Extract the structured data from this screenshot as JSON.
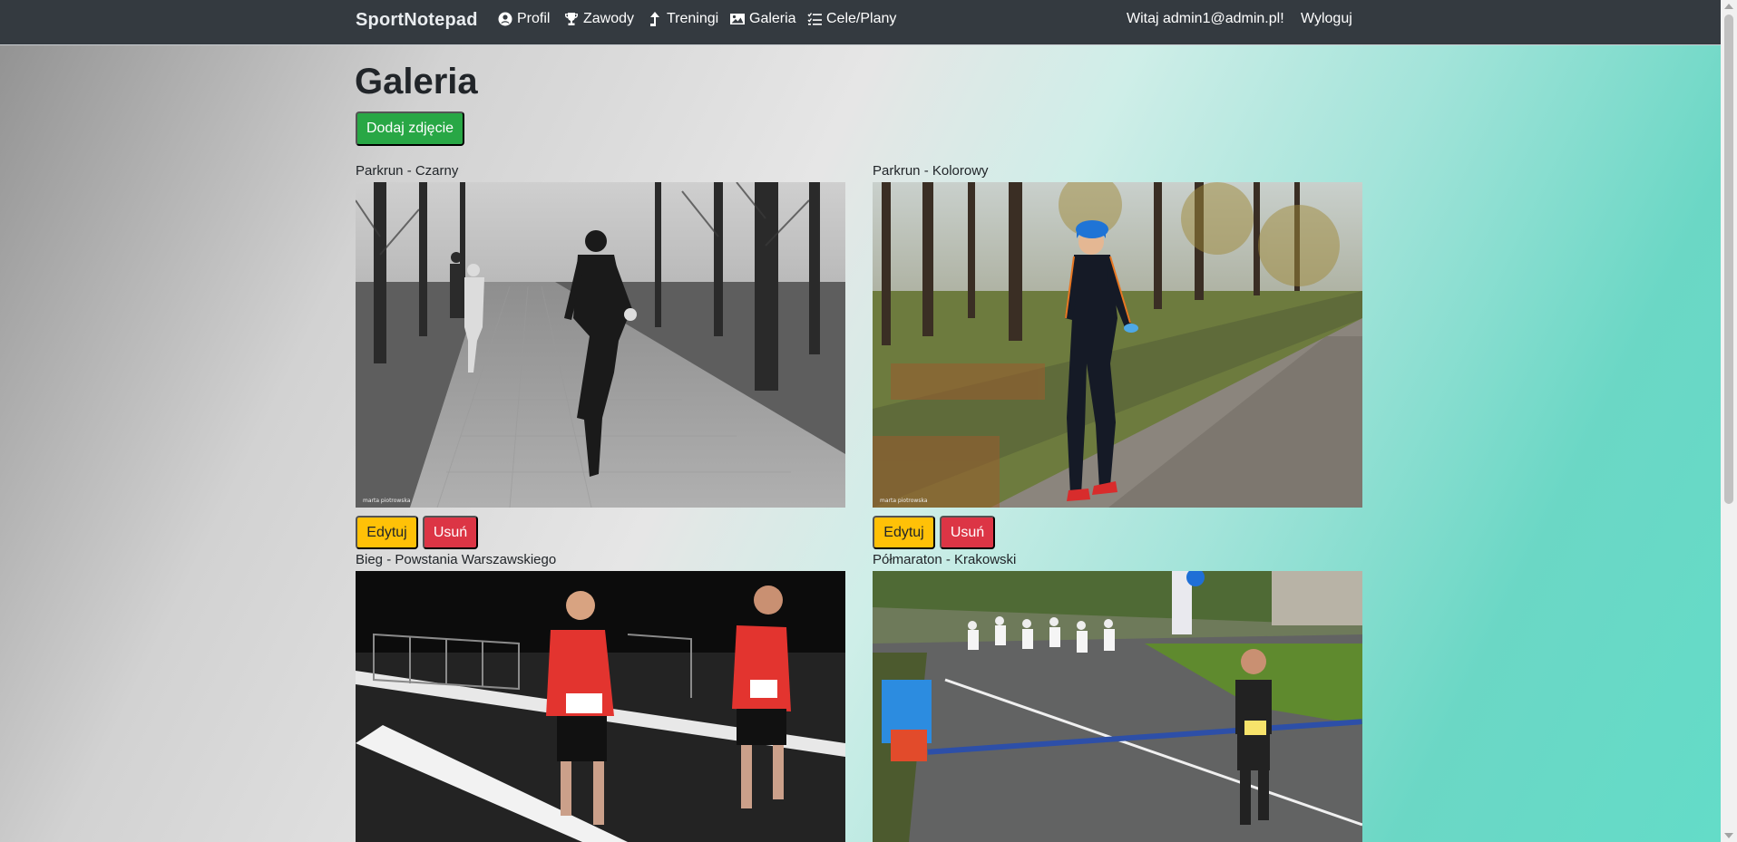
{
  "nav": {
    "brand": "SportNotepad",
    "links": [
      {
        "label": "Profil",
        "icon": "user-circle-icon"
      },
      {
        "label": "Zawody",
        "icon": "trophy-icon"
      },
      {
        "label": "Treningi",
        "icon": "arrow-up-icon"
      },
      {
        "label": "Galeria",
        "icon": "image-icon"
      },
      {
        "label": "Cele/Plany",
        "icon": "tasks-icon"
      }
    ],
    "greeting": "Witaj admin1@admin.pl!",
    "logout": "Wyloguj"
  },
  "page": {
    "title": "Galeria",
    "add_button": "Dodaj zdjęcie"
  },
  "gallery": [
    {
      "title": "Parkrun - Czarny",
      "edit": "Edytuj",
      "delete": "Usuń",
      "watermark": "marta piotrowska"
    },
    {
      "title": "Parkrun - Kolorowy",
      "edit": "Edytuj",
      "delete": "Usuń",
      "watermark": "marta piotrowska"
    },
    {
      "title": "Bieg - Powstania Warszawskiego"
    },
    {
      "title": "Półmaraton - Krakowski"
    }
  ],
  "colors": {
    "navbar": "#343a40",
    "success": "#28a745",
    "warning": "#ffc107",
    "danger": "#dc3545"
  }
}
